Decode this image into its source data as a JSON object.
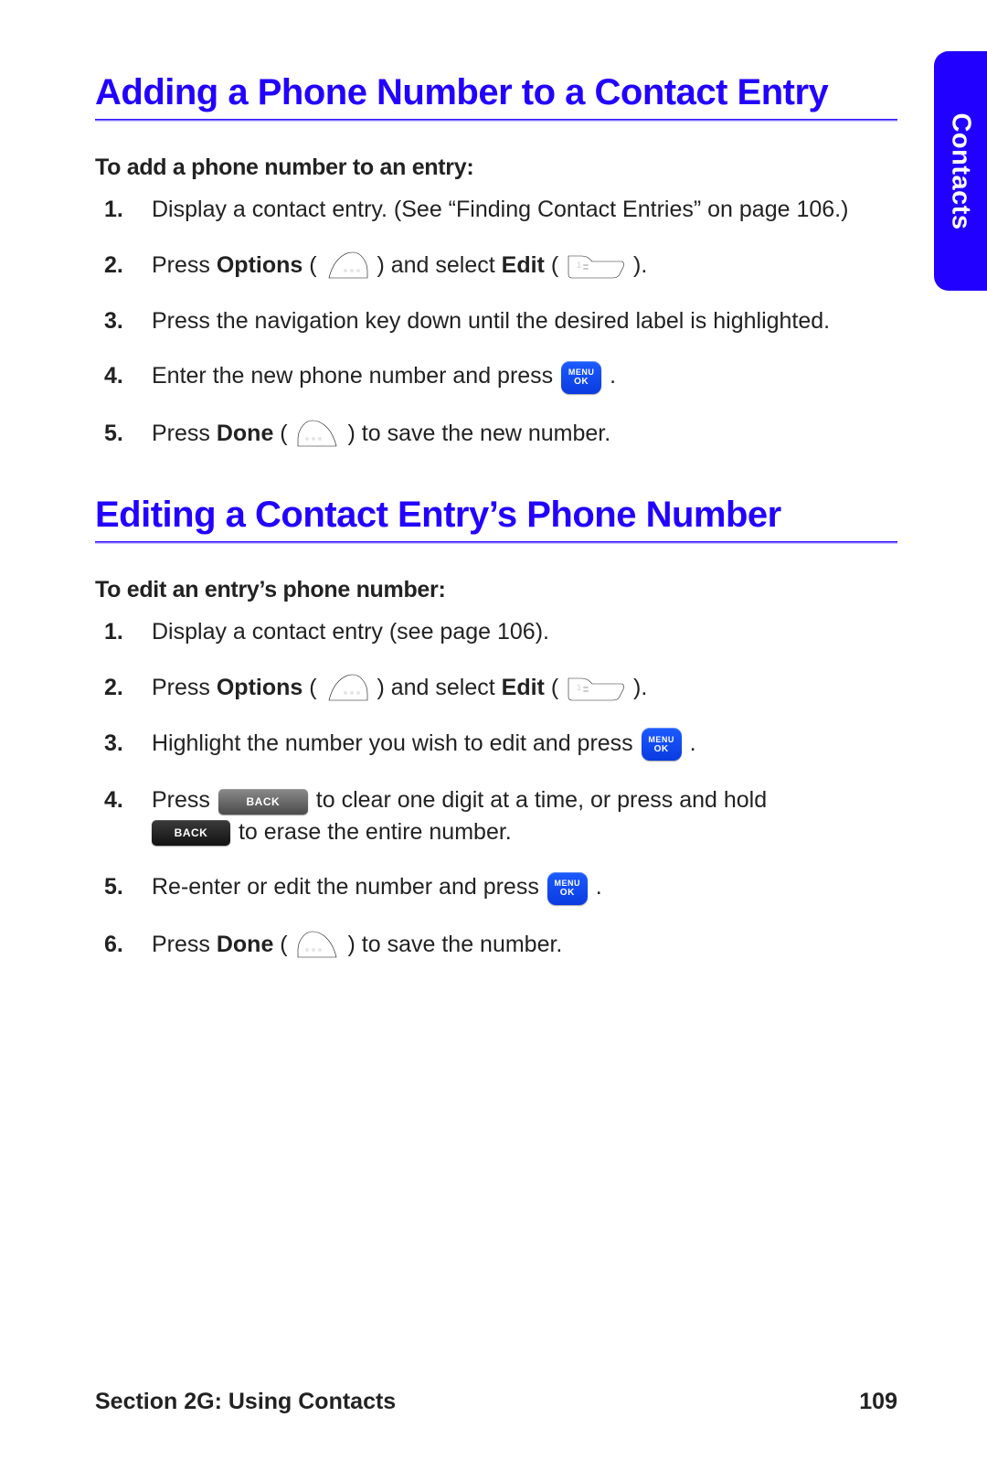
{
  "side_tab": {
    "label": "Contacts"
  },
  "section_a": {
    "title": "Adding a Phone Number to a Contact Entry",
    "intro": "To add a phone number to an entry:",
    "steps": {
      "s1": "Display a contact entry. (See “Finding Contact Entries” on page 106.)",
      "s2a": "Press ",
      "s2_options": "Options",
      "s2b": " ( ",
      "s2c": " ) and select ",
      "s2_edit": "Edit",
      "s2d": " ( ",
      "s2e": " ).",
      "s3": "Press the navigation key down until the desired label is highlighted.",
      "s4a": "Enter the new phone number and press ",
      "s4b": " .",
      "s5a": "Press ",
      "s5_done": "Done",
      "s5b": " ( ",
      "s5c": " ) to save the new number."
    }
  },
  "section_b": {
    "title": "Editing a Contact Entry’s Phone Number",
    "intro": "To edit an entry’s phone number:",
    "steps": {
      "s1": "Display a contact entry (see page 106).",
      "s2a": "Press ",
      "s2_options": "Options",
      "s2b": " ( ",
      "s2c": " ) and select ",
      "s2_edit": "Edit",
      "s2d": " ( ",
      "s2e": " ).",
      "s3a": "Highlight the number you wish to edit and press ",
      "s3b": " .",
      "s4a": "Press ",
      "s4b": " to clear one digit at a time, or press and hold ",
      "s4c": " to erase the entire number.",
      "s5a": "Re-enter or edit the number and press ",
      "s5b": " .",
      "s6a": "Press ",
      "s6_done": "Done",
      "s6b": " ( ",
      "s6c": " ) to save the number."
    }
  },
  "icons": {
    "menuok_line1": "MENU",
    "menuok_line2": "OK",
    "back_label": "BACK"
  },
  "footer": {
    "left": "Section 2G: Using Contacts",
    "right": "109"
  }
}
